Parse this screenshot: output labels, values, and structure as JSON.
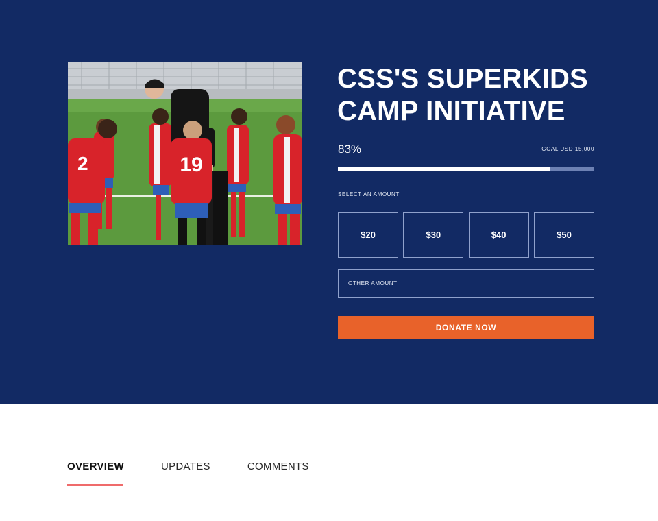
{
  "campaign": {
    "title_line1": "CSS'S SUPERKIDS",
    "title_line2": "CAMP INITIATIVE",
    "progress_label": "83%",
    "progress_fraction": 0.83,
    "goal_label": "GOAL USD 15,000"
  },
  "donation": {
    "select_label": "SELECT AN AMOUNT",
    "amounts": [
      "$20",
      "$30",
      "$40",
      "$50"
    ],
    "other_placeholder": "OTHER AMOUNT",
    "donate_label": "DONATE NOW"
  },
  "tabs": [
    {
      "label": "OVERVIEW",
      "active": true
    },
    {
      "label": "UPDATES",
      "active": false
    },
    {
      "label": "COMMENTS",
      "active": false
    }
  ],
  "colors": {
    "hero_bg": "#122a64",
    "accent_orange": "#e8622a",
    "tab_underline": "#ef6b6b"
  },
  "photo": {
    "subject": "coach-with-youth-soccer-team",
    "jersey_number": "19"
  }
}
